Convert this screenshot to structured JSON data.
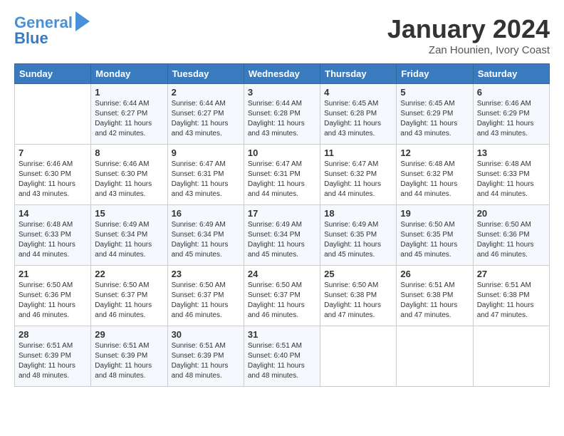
{
  "header": {
    "logo_line1": "General",
    "logo_line2": "Blue",
    "month": "January 2024",
    "location": "Zan Hounien, Ivory Coast"
  },
  "weekdays": [
    "Sunday",
    "Monday",
    "Tuesday",
    "Wednesday",
    "Thursday",
    "Friday",
    "Saturday"
  ],
  "weeks": [
    [
      {
        "day": "",
        "info": ""
      },
      {
        "day": "1",
        "info": "Sunrise: 6:44 AM\nSunset: 6:27 PM\nDaylight: 11 hours\nand 42 minutes."
      },
      {
        "day": "2",
        "info": "Sunrise: 6:44 AM\nSunset: 6:27 PM\nDaylight: 11 hours\nand 43 minutes."
      },
      {
        "day": "3",
        "info": "Sunrise: 6:44 AM\nSunset: 6:28 PM\nDaylight: 11 hours\nand 43 minutes."
      },
      {
        "day": "4",
        "info": "Sunrise: 6:45 AM\nSunset: 6:28 PM\nDaylight: 11 hours\nand 43 minutes."
      },
      {
        "day": "5",
        "info": "Sunrise: 6:45 AM\nSunset: 6:29 PM\nDaylight: 11 hours\nand 43 minutes."
      },
      {
        "day": "6",
        "info": "Sunrise: 6:46 AM\nSunset: 6:29 PM\nDaylight: 11 hours\nand 43 minutes."
      }
    ],
    [
      {
        "day": "7",
        "info": "Sunrise: 6:46 AM\nSunset: 6:30 PM\nDaylight: 11 hours\nand 43 minutes."
      },
      {
        "day": "8",
        "info": "Sunrise: 6:46 AM\nSunset: 6:30 PM\nDaylight: 11 hours\nand 43 minutes."
      },
      {
        "day": "9",
        "info": "Sunrise: 6:47 AM\nSunset: 6:31 PM\nDaylight: 11 hours\nand 43 minutes."
      },
      {
        "day": "10",
        "info": "Sunrise: 6:47 AM\nSunset: 6:31 PM\nDaylight: 11 hours\nand 44 minutes."
      },
      {
        "day": "11",
        "info": "Sunrise: 6:47 AM\nSunset: 6:32 PM\nDaylight: 11 hours\nand 44 minutes."
      },
      {
        "day": "12",
        "info": "Sunrise: 6:48 AM\nSunset: 6:32 PM\nDaylight: 11 hours\nand 44 minutes."
      },
      {
        "day": "13",
        "info": "Sunrise: 6:48 AM\nSunset: 6:33 PM\nDaylight: 11 hours\nand 44 minutes."
      }
    ],
    [
      {
        "day": "14",
        "info": "Sunrise: 6:48 AM\nSunset: 6:33 PM\nDaylight: 11 hours\nand 44 minutes."
      },
      {
        "day": "15",
        "info": "Sunrise: 6:49 AM\nSunset: 6:34 PM\nDaylight: 11 hours\nand 44 minutes."
      },
      {
        "day": "16",
        "info": "Sunrise: 6:49 AM\nSunset: 6:34 PM\nDaylight: 11 hours\nand 45 minutes."
      },
      {
        "day": "17",
        "info": "Sunrise: 6:49 AM\nSunset: 6:34 PM\nDaylight: 11 hours\nand 45 minutes."
      },
      {
        "day": "18",
        "info": "Sunrise: 6:49 AM\nSunset: 6:35 PM\nDaylight: 11 hours\nand 45 minutes."
      },
      {
        "day": "19",
        "info": "Sunrise: 6:50 AM\nSunset: 6:35 PM\nDaylight: 11 hours\nand 45 minutes."
      },
      {
        "day": "20",
        "info": "Sunrise: 6:50 AM\nSunset: 6:36 PM\nDaylight: 11 hours\nand 46 minutes."
      }
    ],
    [
      {
        "day": "21",
        "info": "Sunrise: 6:50 AM\nSunset: 6:36 PM\nDaylight: 11 hours\nand 46 minutes."
      },
      {
        "day": "22",
        "info": "Sunrise: 6:50 AM\nSunset: 6:37 PM\nDaylight: 11 hours\nand 46 minutes."
      },
      {
        "day": "23",
        "info": "Sunrise: 6:50 AM\nSunset: 6:37 PM\nDaylight: 11 hours\nand 46 minutes."
      },
      {
        "day": "24",
        "info": "Sunrise: 6:50 AM\nSunset: 6:37 PM\nDaylight: 11 hours\nand 46 minutes."
      },
      {
        "day": "25",
        "info": "Sunrise: 6:50 AM\nSunset: 6:38 PM\nDaylight: 11 hours\nand 47 minutes."
      },
      {
        "day": "26",
        "info": "Sunrise: 6:51 AM\nSunset: 6:38 PM\nDaylight: 11 hours\nand 47 minutes."
      },
      {
        "day": "27",
        "info": "Sunrise: 6:51 AM\nSunset: 6:38 PM\nDaylight: 11 hours\nand 47 minutes."
      }
    ],
    [
      {
        "day": "28",
        "info": "Sunrise: 6:51 AM\nSunset: 6:39 PM\nDaylight: 11 hours\nand 48 minutes."
      },
      {
        "day": "29",
        "info": "Sunrise: 6:51 AM\nSunset: 6:39 PM\nDaylight: 11 hours\nand 48 minutes."
      },
      {
        "day": "30",
        "info": "Sunrise: 6:51 AM\nSunset: 6:39 PM\nDaylight: 11 hours\nand 48 minutes."
      },
      {
        "day": "31",
        "info": "Sunrise: 6:51 AM\nSunset: 6:40 PM\nDaylight: 11 hours\nand 48 minutes."
      },
      {
        "day": "",
        "info": ""
      },
      {
        "day": "",
        "info": ""
      },
      {
        "day": "",
        "info": ""
      }
    ]
  ]
}
